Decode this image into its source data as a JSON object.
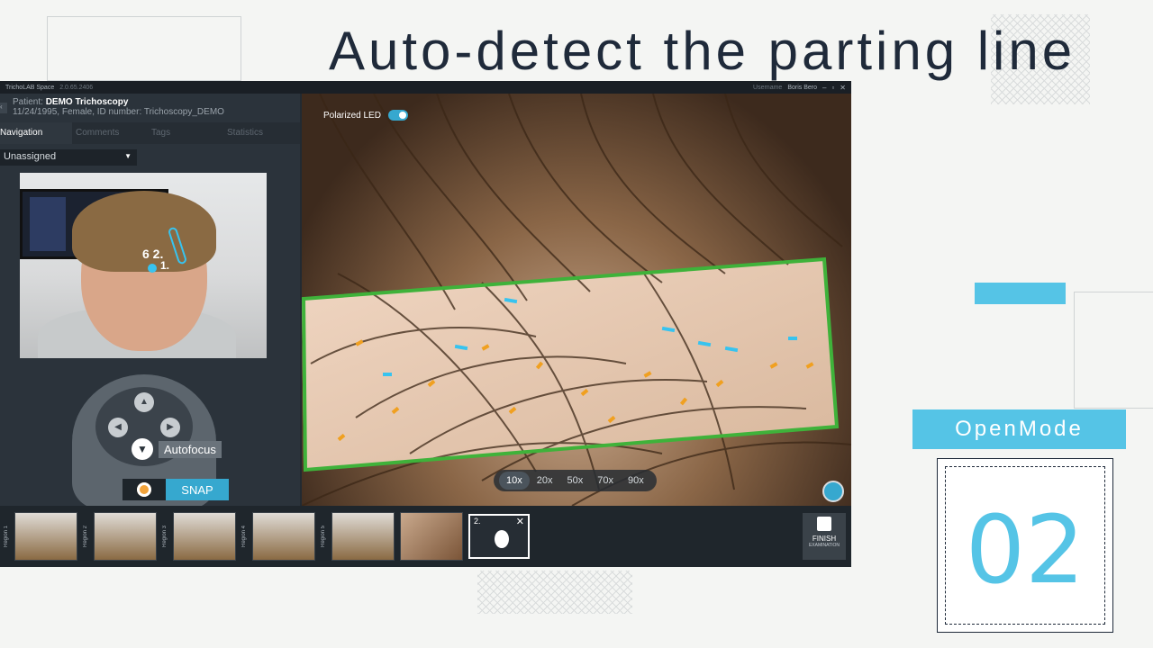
{
  "slide": {
    "title": "Auto-detect the parting line",
    "mode_label": "OpenMode",
    "number": "02"
  },
  "app": {
    "name": "TrichoLAB Space",
    "version": "2.0.65.2406",
    "username_label": "Username",
    "username": "Boris Bero",
    "patient": {
      "label": "Patient:",
      "name": "DEMO Trichoscopy",
      "details": "11/24/1995, Female, ID number: Trichoscopy_DEMO"
    },
    "tabs": [
      {
        "label": "Navigation",
        "active": true
      },
      {
        "label": "Comments",
        "active": false
      },
      {
        "label": "Tags",
        "active": false
      },
      {
        "label": "Statistics",
        "active": false
      }
    ],
    "region_select": "Unassigned",
    "controls": {
      "autofocus_label": "Autofocus",
      "snap_label": "SNAP"
    },
    "view": {
      "polarized_led_label": "Polarized LED",
      "polarized_led_on": true,
      "zoom_levels": [
        "10x",
        "20x",
        "50x",
        "70x",
        "90x"
      ],
      "selected_zoom": "10x"
    },
    "filmstrip": {
      "region_labels": [
        "Region 1",
        "Region 2",
        "Region 3",
        "Region 4",
        "Region 5"
      ],
      "active_index": "2.",
      "finish_label": "FINISH",
      "finish_sub": "EXAMINATION"
    }
  },
  "colors": {
    "accent": "#55c4e6",
    "detection_box": "#3fb23a",
    "follicle_orange": "#f0a020",
    "follicle_blue": "#37c3ef"
  }
}
